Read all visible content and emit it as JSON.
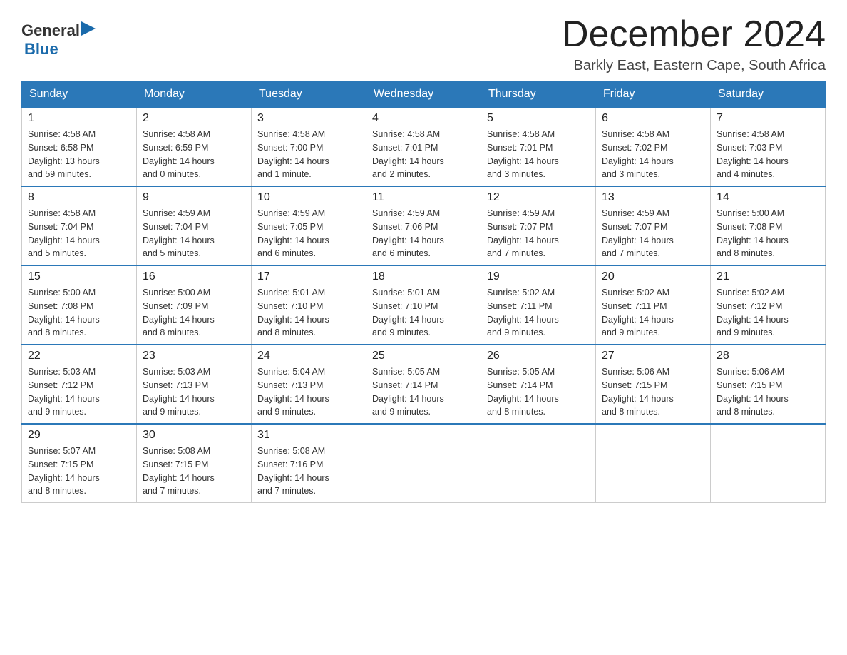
{
  "header": {
    "logo_general": "General",
    "logo_blue": "Blue",
    "month_title": "December 2024",
    "location": "Barkly East, Eastern Cape, South Africa"
  },
  "days_of_week": [
    "Sunday",
    "Monday",
    "Tuesday",
    "Wednesday",
    "Thursday",
    "Friday",
    "Saturday"
  ],
  "weeks": [
    [
      {
        "day": "1",
        "sunrise": "4:58 AM",
        "sunset": "6:58 PM",
        "daylight": "13 hours and 59 minutes."
      },
      {
        "day": "2",
        "sunrise": "4:58 AM",
        "sunset": "6:59 PM",
        "daylight": "14 hours and 0 minutes."
      },
      {
        "day": "3",
        "sunrise": "4:58 AM",
        "sunset": "7:00 PM",
        "daylight": "14 hours and 1 minute."
      },
      {
        "day": "4",
        "sunrise": "4:58 AM",
        "sunset": "7:01 PM",
        "daylight": "14 hours and 2 minutes."
      },
      {
        "day": "5",
        "sunrise": "4:58 AM",
        "sunset": "7:01 PM",
        "daylight": "14 hours and 3 minutes."
      },
      {
        "day": "6",
        "sunrise": "4:58 AM",
        "sunset": "7:02 PM",
        "daylight": "14 hours and 3 minutes."
      },
      {
        "day": "7",
        "sunrise": "4:58 AM",
        "sunset": "7:03 PM",
        "daylight": "14 hours and 4 minutes."
      }
    ],
    [
      {
        "day": "8",
        "sunrise": "4:58 AM",
        "sunset": "7:04 PM",
        "daylight": "14 hours and 5 minutes."
      },
      {
        "day": "9",
        "sunrise": "4:59 AM",
        "sunset": "7:04 PM",
        "daylight": "14 hours and 5 minutes."
      },
      {
        "day": "10",
        "sunrise": "4:59 AM",
        "sunset": "7:05 PM",
        "daylight": "14 hours and 6 minutes."
      },
      {
        "day": "11",
        "sunrise": "4:59 AM",
        "sunset": "7:06 PM",
        "daylight": "14 hours and 6 minutes."
      },
      {
        "day": "12",
        "sunrise": "4:59 AM",
        "sunset": "7:07 PM",
        "daylight": "14 hours and 7 minutes."
      },
      {
        "day": "13",
        "sunrise": "4:59 AM",
        "sunset": "7:07 PM",
        "daylight": "14 hours and 7 minutes."
      },
      {
        "day": "14",
        "sunrise": "5:00 AM",
        "sunset": "7:08 PM",
        "daylight": "14 hours and 8 minutes."
      }
    ],
    [
      {
        "day": "15",
        "sunrise": "5:00 AM",
        "sunset": "7:08 PM",
        "daylight": "14 hours and 8 minutes."
      },
      {
        "day": "16",
        "sunrise": "5:00 AM",
        "sunset": "7:09 PM",
        "daylight": "14 hours and 8 minutes."
      },
      {
        "day": "17",
        "sunrise": "5:01 AM",
        "sunset": "7:10 PM",
        "daylight": "14 hours and 8 minutes."
      },
      {
        "day": "18",
        "sunrise": "5:01 AM",
        "sunset": "7:10 PM",
        "daylight": "14 hours and 9 minutes."
      },
      {
        "day": "19",
        "sunrise": "5:02 AM",
        "sunset": "7:11 PM",
        "daylight": "14 hours and 9 minutes."
      },
      {
        "day": "20",
        "sunrise": "5:02 AM",
        "sunset": "7:11 PM",
        "daylight": "14 hours and 9 minutes."
      },
      {
        "day": "21",
        "sunrise": "5:02 AM",
        "sunset": "7:12 PM",
        "daylight": "14 hours and 9 minutes."
      }
    ],
    [
      {
        "day": "22",
        "sunrise": "5:03 AM",
        "sunset": "7:12 PM",
        "daylight": "14 hours and 9 minutes."
      },
      {
        "day": "23",
        "sunrise": "5:03 AM",
        "sunset": "7:13 PM",
        "daylight": "14 hours and 9 minutes."
      },
      {
        "day": "24",
        "sunrise": "5:04 AM",
        "sunset": "7:13 PM",
        "daylight": "14 hours and 9 minutes."
      },
      {
        "day": "25",
        "sunrise": "5:05 AM",
        "sunset": "7:14 PM",
        "daylight": "14 hours and 9 minutes."
      },
      {
        "day": "26",
        "sunrise": "5:05 AM",
        "sunset": "7:14 PM",
        "daylight": "14 hours and 8 minutes."
      },
      {
        "day": "27",
        "sunrise": "5:06 AM",
        "sunset": "7:15 PM",
        "daylight": "14 hours and 8 minutes."
      },
      {
        "day": "28",
        "sunrise": "5:06 AM",
        "sunset": "7:15 PM",
        "daylight": "14 hours and 8 minutes."
      }
    ],
    [
      {
        "day": "29",
        "sunrise": "5:07 AM",
        "sunset": "7:15 PM",
        "daylight": "14 hours and 8 minutes."
      },
      {
        "day": "30",
        "sunrise": "5:08 AM",
        "sunset": "7:15 PM",
        "daylight": "14 hours and 7 minutes."
      },
      {
        "day": "31",
        "sunrise": "5:08 AM",
        "sunset": "7:16 PM",
        "daylight": "14 hours and 7 minutes."
      },
      null,
      null,
      null,
      null
    ]
  ],
  "labels": {
    "sunrise": "Sunrise:",
    "sunset": "Sunset:",
    "daylight": "Daylight:"
  }
}
